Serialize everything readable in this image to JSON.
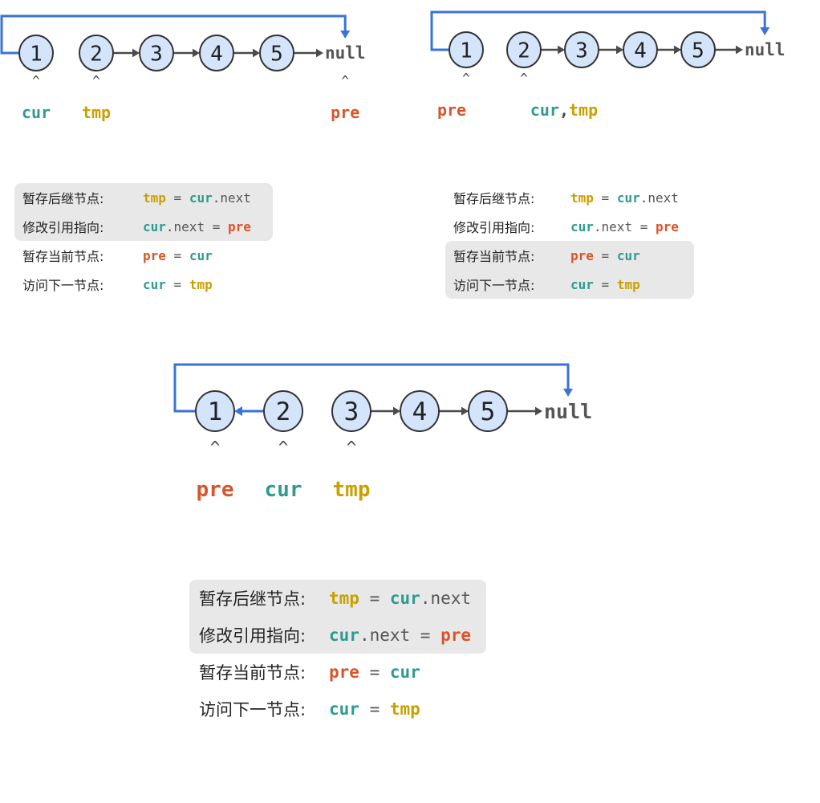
{
  "colors": {
    "node_fill": "#d4e4fb",
    "node_stroke": "#333333",
    "arrow": "#4a4a4a",
    "link_blue": "#3a72d8",
    "pre": "#d9542a",
    "cur": "#2e9b8f",
    "tmp": "#c9a000"
  },
  "panels": [
    {
      "id": "panel-1",
      "nodes": [
        "1",
        "2",
        "3",
        "4",
        "5"
      ],
      "null_label": "null",
      "caret": "^",
      "pointers": [
        {
          "target": "1",
          "parts": [
            {
              "text": "cur",
              "role": "cur"
            }
          ]
        },
        {
          "target": "2",
          "parts": [
            {
              "text": "tmp",
              "role": "tmp"
            }
          ]
        },
        {
          "target": "null",
          "parts": [
            {
              "text": "pre",
              "role": "pre"
            }
          ]
        }
      ],
      "code": [
        {
          "label": "暂存后继节点:",
          "tokens": [
            {
              "t": "tmp",
              "r": "tmp"
            },
            {
              "t": " = ",
              "r": "op"
            },
            {
              "t": "cur",
              "r": "cur"
            },
            {
              "t": ".next",
              "r": "op"
            }
          ]
        },
        {
          "label": "修改引用指向:",
          "tokens": [
            {
              "t": "cur",
              "r": "cur"
            },
            {
              "t": ".next = ",
              "r": "op"
            },
            {
              "t": "pre",
              "r": "pre"
            }
          ]
        },
        {
          "label": "暂存当前节点:",
          "tokens": [
            {
              "t": "pre",
              "r": "pre"
            },
            {
              "t": " = ",
              "r": "op"
            },
            {
              "t": "cur",
              "r": "cur"
            }
          ]
        },
        {
          "label": "访问下一节点:",
          "tokens": [
            {
              "t": "cur",
              "r": "cur"
            },
            {
              "t": " = ",
              "r": "op"
            },
            {
              "t": "tmp",
              "r": "tmp"
            }
          ]
        }
      ],
      "highlighted_lines": [
        0,
        1
      ]
    },
    {
      "id": "panel-2",
      "nodes": [
        "1",
        "2",
        "3",
        "4",
        "5"
      ],
      "null_label": "null",
      "caret": "^",
      "pointers": [
        {
          "target": "1",
          "parts": [
            {
              "text": "pre",
              "role": "pre"
            }
          ]
        },
        {
          "target": "2",
          "parts": [
            {
              "text": "cur",
              "role": "cur"
            },
            {
              "text": ",",
              "role": "op"
            },
            {
              "text": "tmp",
              "role": "tmp"
            }
          ]
        }
      ],
      "code": [
        {
          "label": "暂存后继节点:",
          "tokens": [
            {
              "t": "tmp",
              "r": "tmp"
            },
            {
              "t": " = ",
              "r": "op"
            },
            {
              "t": "cur",
              "r": "cur"
            },
            {
              "t": ".next",
              "r": "op"
            }
          ]
        },
        {
          "label": "修改引用指向:",
          "tokens": [
            {
              "t": "cur",
              "r": "cur"
            },
            {
              "t": ".next = ",
              "r": "op"
            },
            {
              "t": "pre",
              "r": "pre"
            }
          ]
        },
        {
          "label": "暂存当前节点:",
          "tokens": [
            {
              "t": "pre",
              "r": "pre"
            },
            {
              "t": " = ",
              "r": "op"
            },
            {
              "t": "cur",
              "r": "cur"
            }
          ]
        },
        {
          "label": "访问下一节点:",
          "tokens": [
            {
              "t": "cur",
              "r": "cur"
            },
            {
              "t": " = ",
              "r": "op"
            },
            {
              "t": "tmp",
              "r": "tmp"
            }
          ]
        }
      ],
      "highlighted_lines": [
        2,
        3
      ]
    },
    {
      "id": "panel-3",
      "nodes": [
        "1",
        "2",
        "3",
        "4",
        "5"
      ],
      "null_label": "null",
      "caret": "^",
      "pointers": [
        {
          "target": "1",
          "parts": [
            {
              "text": "pre",
              "role": "pre"
            }
          ]
        },
        {
          "target": "2",
          "parts": [
            {
              "text": "cur",
              "role": "cur"
            }
          ]
        },
        {
          "target": "3",
          "parts": [
            {
              "text": "tmp",
              "role": "tmp"
            }
          ]
        }
      ],
      "code": [
        {
          "label": "暂存后继节点:",
          "tokens": [
            {
              "t": "tmp",
              "r": "tmp"
            },
            {
              "t": " = ",
              "r": "op"
            },
            {
              "t": "cur",
              "r": "cur"
            },
            {
              "t": ".next",
              "r": "op"
            }
          ]
        },
        {
          "label": "修改引用指向:",
          "tokens": [
            {
              "t": "cur",
              "r": "cur"
            },
            {
              "t": ".next = ",
              "r": "op"
            },
            {
              "t": "pre",
              "r": "pre"
            }
          ]
        },
        {
          "label": "暂存当前节点:",
          "tokens": [
            {
              "t": "pre",
              "r": "pre"
            },
            {
              "t": " = ",
              "r": "op"
            },
            {
              "t": "cur",
              "r": "cur"
            }
          ]
        },
        {
          "label": "访问下一节点:",
          "tokens": [
            {
              "t": "cur",
              "r": "cur"
            },
            {
              "t": " = ",
              "r": "op"
            },
            {
              "t": "tmp",
              "r": "tmp"
            }
          ]
        }
      ],
      "highlighted_lines": [
        0,
        1
      ]
    }
  ]
}
